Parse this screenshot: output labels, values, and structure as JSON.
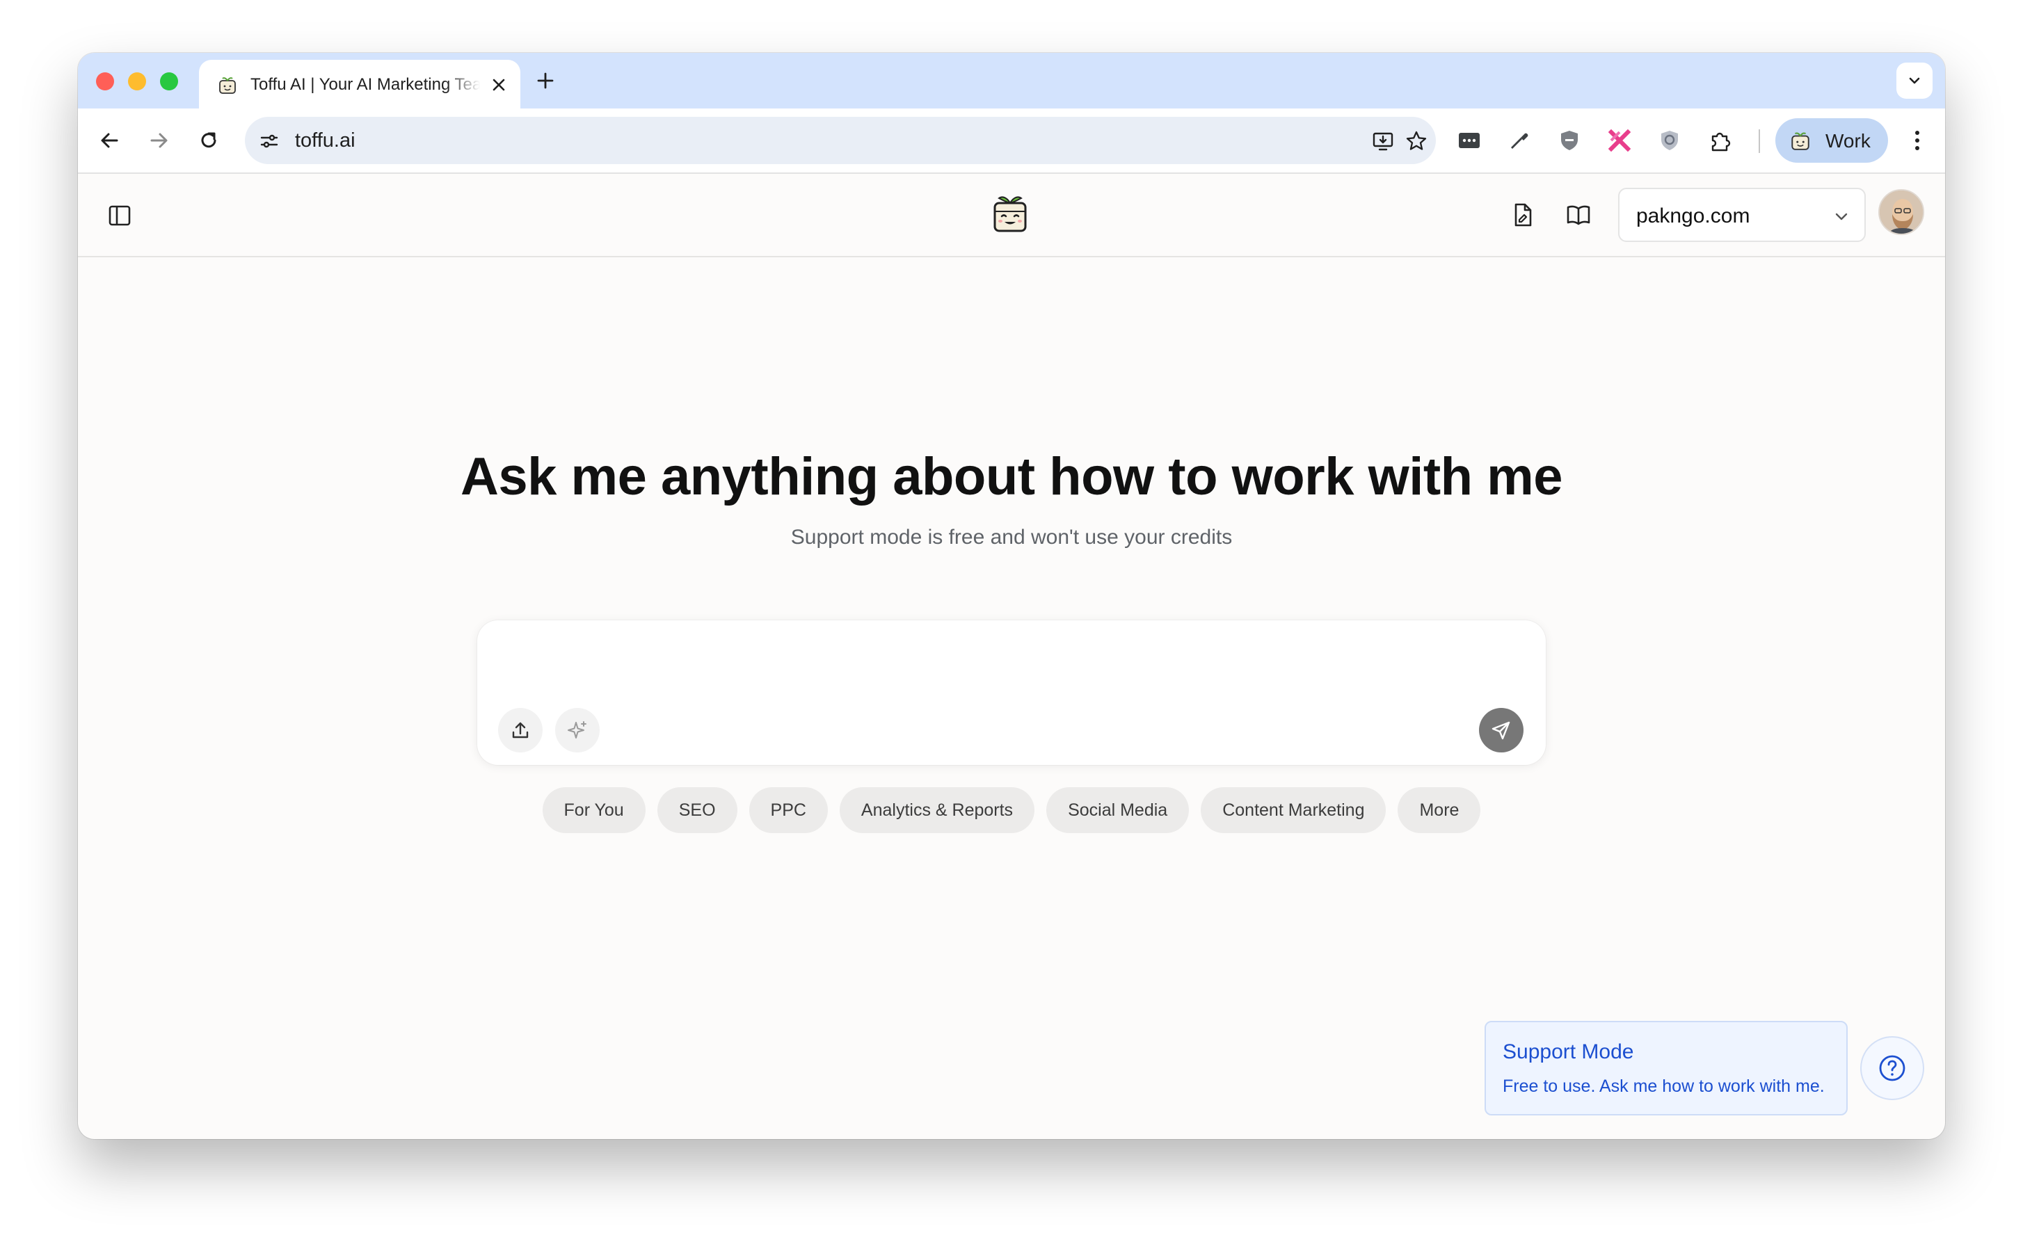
{
  "browser": {
    "tab_title": "Toffu AI | Your AI Marketing Team",
    "url": "toffu.ai",
    "profile_label": "Work"
  },
  "header": {
    "domain_selected": "pakngo.com"
  },
  "main": {
    "headline": "Ask me anything about how to work with me",
    "subline": "Support mode is free and won't use your credits",
    "prompt_placeholder": "",
    "chips": [
      "For You",
      "SEO",
      "PPC",
      "Analytics & Reports",
      "Social Media",
      "Content Marketing",
      "More"
    ]
  },
  "support": {
    "title": "Support Mode",
    "text": "Free to use. Ask me how to work with me."
  },
  "colors": {
    "tabstrip": "#d3e3fd",
    "page_bg": "#fcfbfa",
    "support_accent": "#1c4fd0",
    "send_button": "#777777"
  },
  "icons": [
    "tofu-favicon-icon",
    "close-icon",
    "plus-icon",
    "chevron-down-icon",
    "back-arrow-icon",
    "forward-arrow-icon",
    "reload-icon",
    "site-settings-icon",
    "install-app-icon",
    "star-icon",
    "password-manager-icon",
    "eyedropper-icon",
    "shield-icon",
    "ext-cross-icon",
    "privacy-shield-icon",
    "puzzle-icon",
    "more-vert-icon",
    "sidebar-toggle-icon",
    "tofu-logo-icon",
    "document-icon",
    "book-open-icon",
    "upload-icon",
    "sparkle-icon",
    "send-icon",
    "help-circle-icon"
  ]
}
